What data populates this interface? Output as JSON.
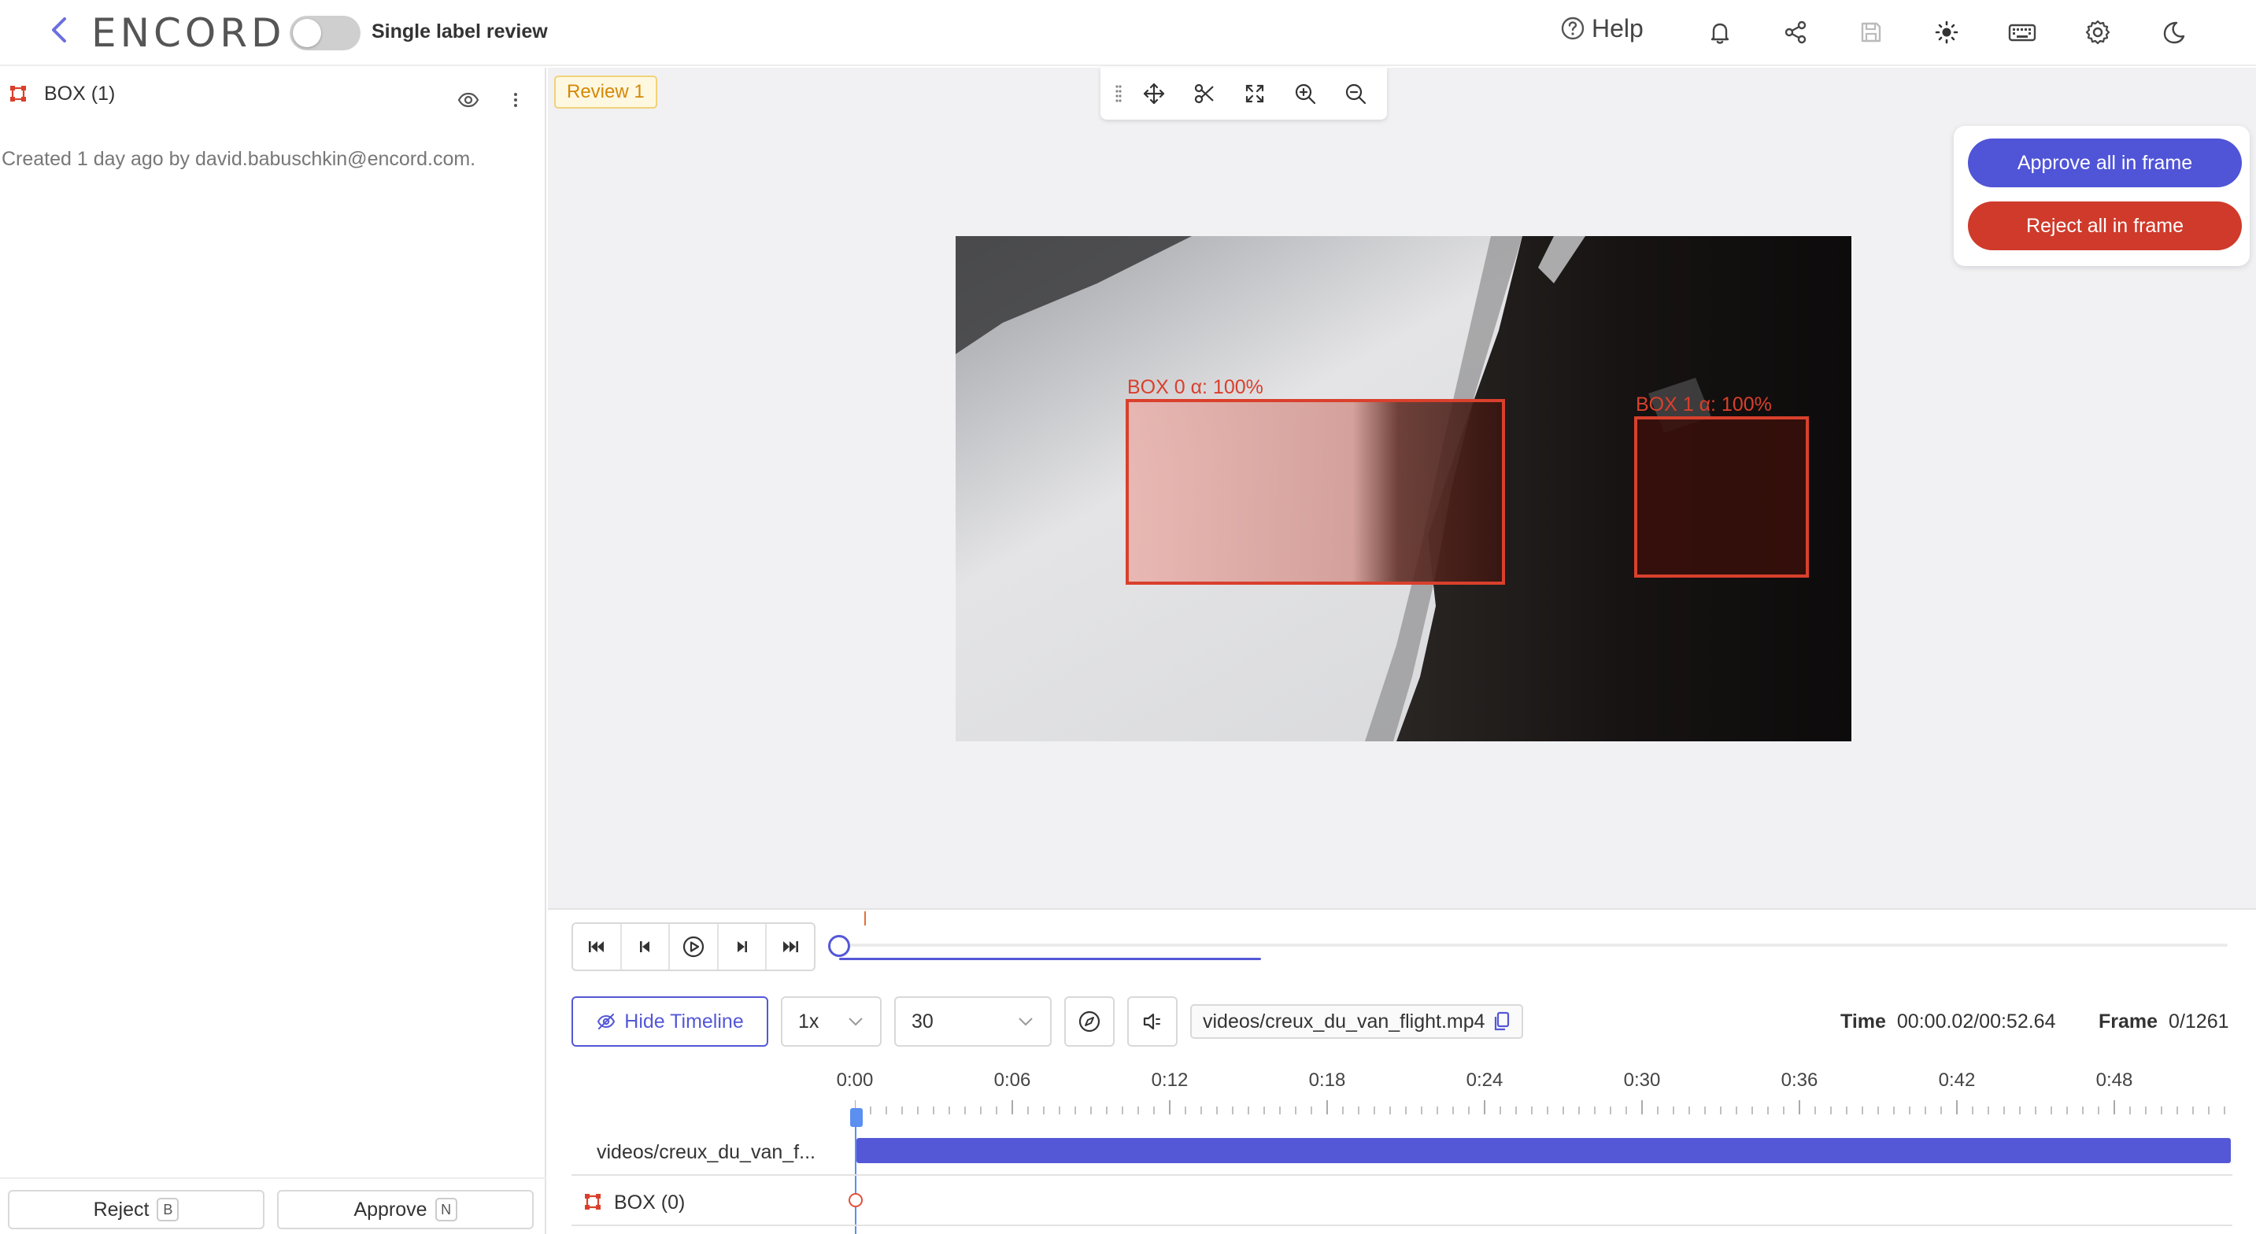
{
  "colors": {
    "accent": "#5458d6",
    "approve": "#5054d6",
    "reject": "#cf3a2b",
    "box_stroke": "#d9402c",
    "playhead": "#5b8ff0"
  },
  "header": {
    "logo_text": "ENCORD",
    "toggle_label": "Single label review",
    "help_label": "Help",
    "icons": [
      "bell-icon",
      "share-icon",
      "save-icon",
      "sun-icon",
      "keyboard-icon",
      "settings-icon",
      "moon-icon"
    ]
  },
  "left_panel": {
    "object_label": "BOX (1)",
    "created_text": "Created 1 day ago by david.babuschkin@encord.com.",
    "reject_label": "Reject",
    "reject_key": "B",
    "approve_label": "Approve",
    "approve_key": "N"
  },
  "canvas": {
    "review_tag": "Review 1",
    "toolbar_icons": [
      "drag-handle-icon",
      "move-icon",
      "scissors-icon",
      "fullscreen-icon",
      "zoom-in-icon",
      "zoom-out-icon"
    ],
    "approve_all_label": "Approve all in frame",
    "reject_all_label": "Reject all in frame",
    "boxes": [
      {
        "label": "BOX 0 α: 100%"
      },
      {
        "label": "BOX 1 α: 100%"
      }
    ]
  },
  "controls": {
    "hide_timeline_label": "Hide Timeline",
    "speed_value": "1x",
    "fps_value": "30",
    "file_name": "videos/creux_du_van_flight.mp4",
    "time_label": "Time",
    "time_value": "00:00.02/00:52.64",
    "frame_label": "Frame",
    "frame_value": "0/1261",
    "playback_progress": 0.0
  },
  "timeline": {
    "ticks": [
      "0:00",
      "0:06",
      "0:12",
      "0:18",
      "0:24",
      "0:30",
      "0:36",
      "0:42",
      "0:48"
    ],
    "track_name": "videos/creux_du_van_f...",
    "object_track_label": "BOX (0)"
  }
}
